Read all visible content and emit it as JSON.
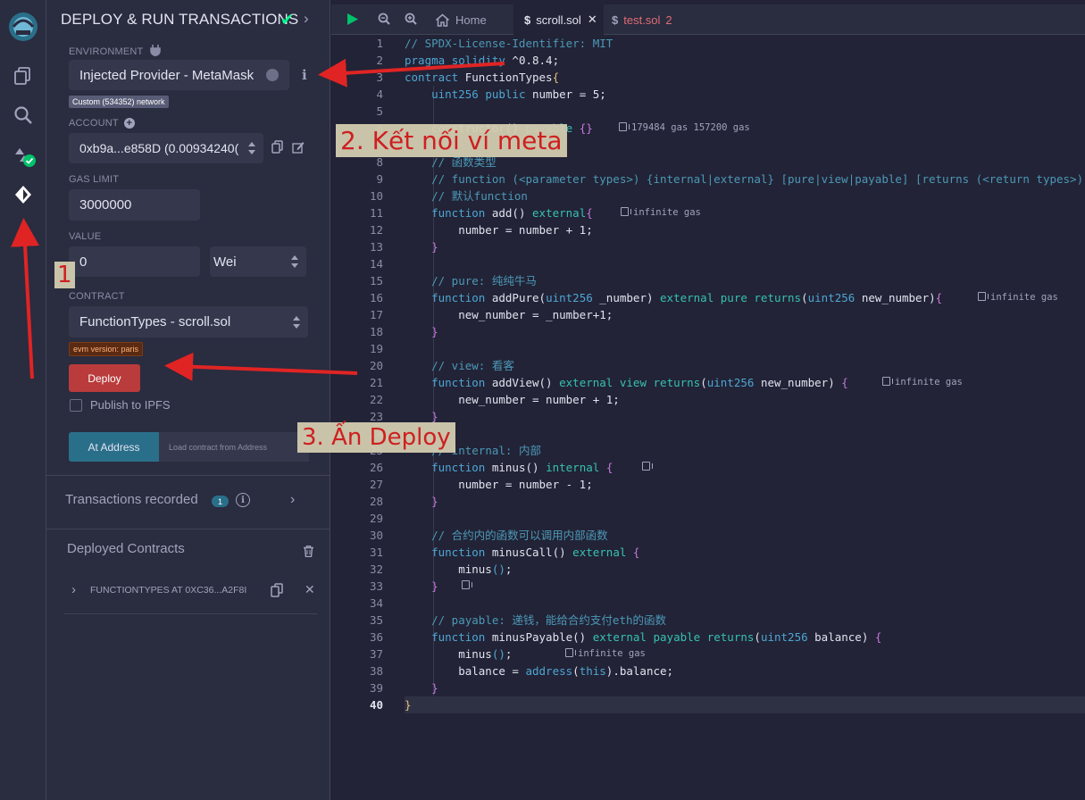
{
  "panel": {
    "title": "DEPLOY & RUN TRANSACTIONS",
    "environment_label": "ENVIRONMENT",
    "environment_value": "Injected Provider - MetaMask",
    "network_badge": "Custom (534352) network",
    "account_label": "ACCOUNT",
    "account_value": "0xb9a...e858D (0.00934240(",
    "gas_limit_label": "GAS LIMIT",
    "gas_limit_value": "3000000",
    "value_label": "VALUE",
    "value_amount": "0",
    "value_unit": "Wei",
    "contract_label": "CONTRACT",
    "contract_value": "FunctionTypes - scroll.sol",
    "evm_badge": "evm version: paris",
    "deploy_label": "Deploy",
    "publish_label": "Publish to IPFS",
    "at_address_label": "At Address",
    "load_contract_placeholder": "Load contract from Address",
    "transactions_recorded_label": "Transactions recorded",
    "transactions_count": "1",
    "info_glyph": "i",
    "deployed_contracts_label": "Deployed Contracts",
    "deployed_item": "FUNCTIONTYPES AT 0XC36...A2F8I"
  },
  "tabs": {
    "home_label": "Home",
    "scroll_tab": "scroll.sol",
    "test_tab": "test.sol",
    "test_tab_count": "2"
  },
  "editor": {
    "line_numbers": [
      "1",
      "2",
      "3",
      "4",
      "5",
      "6",
      "8",
      "9",
      "10",
      "11",
      "12",
      "13",
      "14",
      "15",
      "16",
      "17",
      "18",
      "19",
      "20",
      "21",
      "22",
      "23",
      "24",
      "25",
      "26",
      "27",
      "28",
      "29",
      "30",
      "31",
      "32",
      "33",
      "34",
      "35",
      "36",
      "37",
      "38",
      "39",
      "40"
    ],
    "gas_estimates": {
      "constructor": "179484 gas 157200 gas",
      "add": "infinite gas",
      "addPure": "infinite gas",
      "addView": "infinite gas",
      "minusPayable": "infinite gas"
    }
  },
  "annotations": {
    "step1": "1",
    "step2": "2. Kết nối ví meta",
    "step3": "3. Ấn Deploy"
  },
  "colors": {
    "background": "#222336",
    "panel": "#2a2c3f",
    "accent": "#2a6f8a",
    "deploy_button": "#b93b3b",
    "annotation_arrow": "#e02424"
  }
}
